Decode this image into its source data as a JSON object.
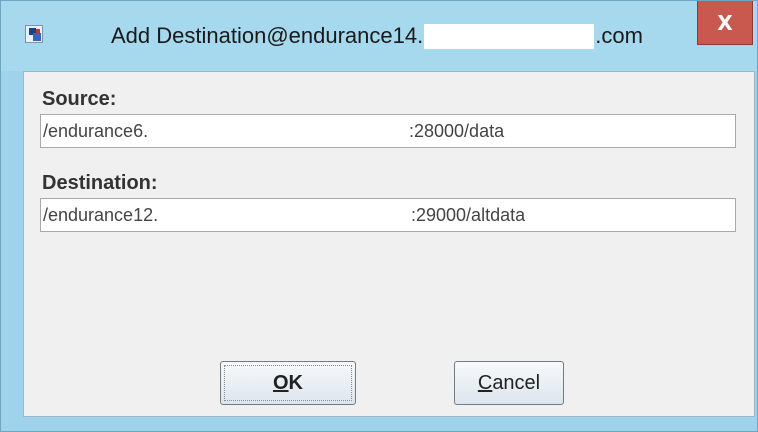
{
  "window": {
    "title_prefix": "Add Destination@endurance14.",
    "title_suffix": ".com",
    "close_label": "X"
  },
  "form": {
    "source": {
      "label": "Source:",
      "value_host": "/endurance6.",
      "value_port_path": ":28000/data"
    },
    "destination": {
      "label": "Destination:",
      "value_host": "/endurance12.",
      "value_port_path": ":29000/altdata"
    }
  },
  "buttons": {
    "ok_mnemonic": "O",
    "ok_rest": "K",
    "cancel_mnemonic": "C",
    "cancel_rest": "ancel"
  },
  "icons": {
    "app": "app-icon",
    "close": "close-icon"
  },
  "colors": {
    "titlebar": "#a6d8ee",
    "close_button": "#c9584f",
    "content_bg": "#f0f0f0"
  }
}
